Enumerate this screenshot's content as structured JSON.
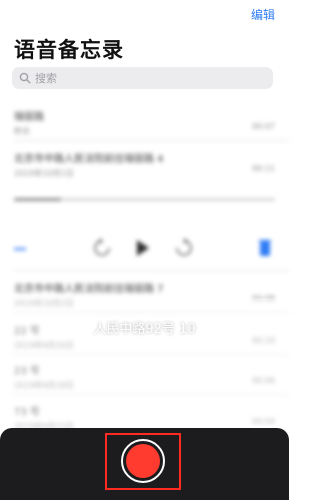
{
  "header": {
    "edit_label": "编辑",
    "title": "语音备忘录"
  },
  "search": {
    "placeholder": "搜索"
  },
  "recordings": [
    {
      "name": "瑞丽路",
      "meta": "昨天",
      "duration": "00:07"
    },
    {
      "name": "北京市中路人民法院前往瑞丽路 4",
      "meta": "2019年10月1日",
      "duration": "00:11"
    },
    {
      "name": "北京市中路人民法院前往瑞丽路 7",
      "meta": "2019年10月2日",
      "duration": "00:08"
    },
    {
      "name": "22 号",
      "meta": "2019年9月20日",
      "duration": "00:10"
    },
    {
      "name": "23 号",
      "meta": "2019年9月18日",
      "duration": "00:06"
    },
    {
      "name": "73 号",
      "meta": "2019年9月15日",
      "duration": "00:04"
    }
  ],
  "playback": {
    "progress": 0.18
  },
  "recording_sheet": {
    "title": "人民中路92号 10",
    "elapsed": "00:00.67"
  },
  "colors": {
    "accent": "#2f7cf6",
    "record": "#ff3b30",
    "highlight": "#ff2a22",
    "bar": "#1c1c1e"
  },
  "icons": [
    "search-icon",
    "waveform-icon",
    "rewind-icon",
    "play-icon",
    "forward-icon",
    "trash-icon",
    "record-icon"
  ]
}
